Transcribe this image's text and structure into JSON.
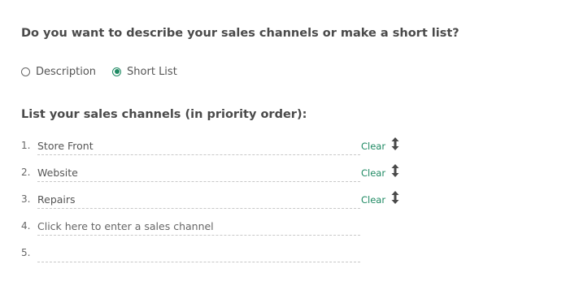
{
  "question": {
    "text": "Do you want to describe your sales channels or make a short list?",
    "options": [
      {
        "label": "Description",
        "selected": false
      },
      {
        "label": "Short List",
        "selected": true
      }
    ]
  },
  "list": {
    "title": "List your sales channels (in priority order):",
    "clear_label": "Clear",
    "placeholder": "Click here to enter a sales channel",
    "rows": [
      {
        "number": "1.",
        "value": "Store Front"
      },
      {
        "number": "2.",
        "value": "Website"
      },
      {
        "number": "3.",
        "value": "Repairs"
      },
      {
        "number": "4.",
        "value": ""
      },
      {
        "number": "5.",
        "value": ""
      }
    ]
  },
  "colors": {
    "accent": "#1f8a63",
    "text": "#555555",
    "heading": "#4a4a4a",
    "divider": "#c8c8c8"
  },
  "icons": {
    "drag": "vertical-drag-arrows-icon"
  }
}
